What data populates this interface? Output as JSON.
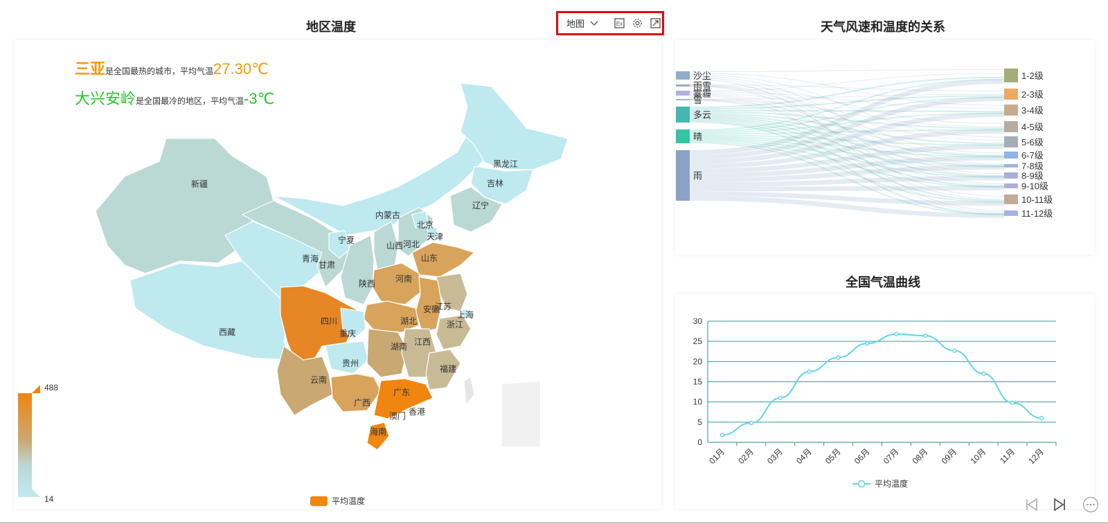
{
  "map_panel": {
    "title": "地区温度",
    "toolbar": {
      "select_label": "地图",
      "icons": [
        "chevron-down-icon",
        "excel-icon",
        "gear-icon",
        "fullscreen-icon"
      ]
    },
    "hot": {
      "city": "三亚",
      "text": "是全国最热的城市，平均气温",
      "value": "27.30℃",
      "color": "#f39800"
    },
    "cold": {
      "city": "大兴安岭",
      "text": "是全国最冷的地区，平均气温",
      "value": "-3℃",
      "color": "#22c722"
    },
    "visual_map": {
      "max": "488",
      "min": "14",
      "color_high": "#f08510",
      "color_low": "#bfe9f0"
    },
    "legend": "平均温度",
    "regions": [
      "新疆",
      "西藏",
      "青海",
      "甘肃",
      "宁夏",
      "内蒙古",
      "黑龙江",
      "吉林",
      "辽宁",
      "北京",
      "天津",
      "河北",
      "山西",
      "陕西",
      "山东",
      "河南",
      "江苏",
      "安徽",
      "上海",
      "浙江",
      "湖北",
      "四川",
      "重庆",
      "贵州",
      "湖南",
      "江西",
      "福建",
      "云南",
      "广西",
      "广东",
      "澳门",
      "香港",
      "海南"
    ]
  },
  "sankey_panel": {
    "title": "天气风速和温度的关系",
    "sources": [
      "沙尘",
      "雨雪",
      "雾霾",
      "雪",
      "多云",
      "晴",
      "雨"
    ],
    "targets": [
      "1-2级",
      "2-3级",
      "3-4级",
      "4-5级",
      "5-6级",
      "6-7级",
      "7-8级",
      "8-9级",
      "9-10级",
      "10-11级",
      "11-12级"
    ],
    "source_colors": [
      "#8fadc8",
      "#9aaac4",
      "#b3aee0",
      "#9fb1c8",
      "#45b6b0",
      "#35c3a4",
      "#8aa2c6"
    ],
    "target_colors": [
      "#a2ad7a",
      "#eda865",
      "#c8ab8e",
      "#b8ab9f",
      "#a5aeb5",
      "#8fb3e8",
      "#a3b3e0",
      "#a8b0d8",
      "#acb0dc",
      "#c1ab98",
      "#a8b2dc"
    ]
  },
  "line_panel": {
    "title": "全国气温曲线",
    "legend": "平均温度",
    "color": "#5fd3e8"
  },
  "chart_data": {
    "type": "line",
    "x": [
      "01月",
      "02月",
      "03月",
      "04月",
      "05月",
      "06月",
      "07月",
      "08月",
      "09月",
      "10月",
      "11月",
      "12月"
    ],
    "series": [
      {
        "name": "平均温度",
        "values": [
          1.8,
          4.8,
          11.0,
          17.5,
          21.0,
          24.5,
          26.8,
          26.4,
          22.7,
          17.0,
          9.8,
          6.0
        ]
      }
    ],
    "yticks": [
      "0",
      "5",
      "10",
      "15",
      "20",
      "25",
      "30"
    ],
    "ylim": [
      0,
      30
    ],
    "grid": true
  }
}
